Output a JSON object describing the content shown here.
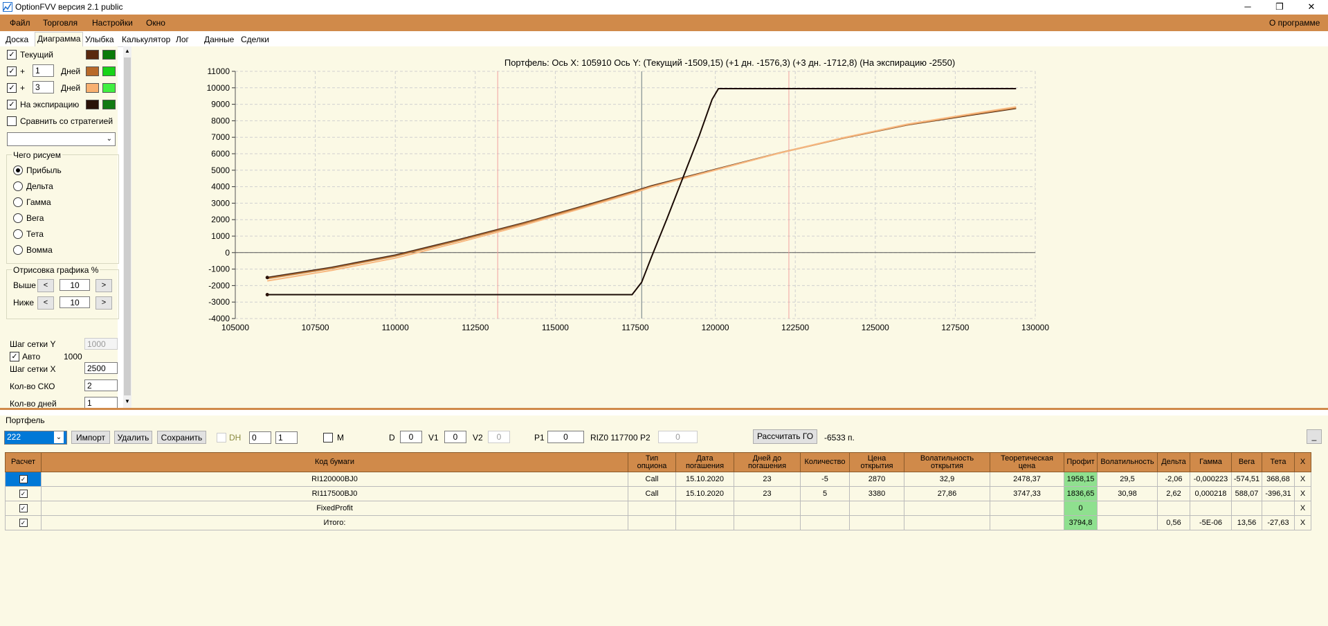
{
  "window": {
    "title": "OptionFVV версия 2.1 public",
    "minimize": "─",
    "restore": "❐",
    "close": "✕"
  },
  "menu": {
    "items": [
      "Файл",
      "Торговля",
      "Настройки",
      "Окно"
    ],
    "about": "О программе"
  },
  "tabs": [
    "Доска",
    "Диаграмма",
    "Улыбка",
    "Калькулятор",
    "Лог",
    "Данные",
    "Сделки"
  ],
  "active_tab": "Диаграмма",
  "left": {
    "current_label": "Текущий",
    "current_checked": "✓",
    "plus1": "+",
    "plus1_value": "1",
    "days1": "Дней",
    "plus3": "+",
    "plus3_value": "3",
    "days3": "Дней",
    "expiry_label": "На экспирацию",
    "compare_label": "Сравнить со стратегией",
    "compare_select": "",
    "what_title": "Чего рисуем",
    "radios": [
      "Прибыль",
      "Дельта",
      "Гамма",
      "Вега",
      "Тета",
      "Вомма"
    ],
    "draw_title": "Отрисовка графика %",
    "above_label": "Выше",
    "above_value": "10",
    "below_label": "Ниже",
    "below_value": "10",
    "arrow_left": "<",
    "arrow_right": ">",
    "grid_y_label": "Шаг сетки Y",
    "grid_y_value": "1000",
    "auto_label": "Авто",
    "auto_value": "1000",
    "grid_x_label": "Шаг сетки X",
    "grid_x_value": "2500",
    "sko_label": "Кол-во СКО",
    "sko_value": "2",
    "days_label": "Кол-во дней",
    "days_value": "1",
    "colors": {
      "current_a": "#5a2a10",
      "current_b": "#0a7a0a",
      "d1_a": "#b86a2a",
      "d1_b": "#18d418",
      "d3_a": "#f8b070",
      "d3_b": "#40f040",
      "exp_a": "#2a1208",
      "exp_b": "#127a12"
    }
  },
  "chart_header": "Портфель: Ось X:  105910 Ось Y:   (Текущий -1509,15)  (+1 дн. -1576,3)  (+3 дн. -1712,8)  (На экспирацию -2550)",
  "chart_data": {
    "type": "line",
    "xlim": [
      105000,
      130000
    ],
    "ylim": [
      -4000,
      11000
    ],
    "x_ticks": [
      "105000",
      "107500",
      "110000",
      "112500",
      "115000",
      "117500",
      "120000",
      "122500",
      "125000",
      "127500",
      "130000"
    ],
    "y_ticks": [
      "11000",
      "10000",
      "9000",
      "8000",
      "7000",
      "6000",
      "5000",
      "4000",
      "3000",
      "2000",
      "1000",
      "0",
      "-1000",
      "-2000",
      "-3000",
      "-4000"
    ],
    "x_tick_values": [
      105000,
      107500,
      110000,
      112500,
      115000,
      117500,
      120000,
      122500,
      125000,
      127500,
      130000
    ],
    "y_tick_values": [
      11000,
      10000,
      9000,
      8000,
      7000,
      6000,
      5000,
      4000,
      3000,
      2000,
      1000,
      0,
      -1000,
      -2000,
      -3000,
      -4000
    ],
    "cursor_x": 117700,
    "sigma_lines": [
      113200,
      122300
    ],
    "series": [
      {
        "color": "#4a2a1a",
        "x": [
          106000,
          108000,
          110000,
          112000,
          114000,
          116000,
          117500,
          118000,
          120000,
          122000,
          124000,
          126000,
          128000,
          129400
        ],
        "y": [
          -1510,
          -900,
          -150,
          800,
          1800,
          2900,
          3750,
          4050,
          5050,
          6050,
          6950,
          7750,
          8350,
          8750
        ]
      },
      {
        "color": "#c07a3a",
        "x": [
          106000,
          108000,
          110000,
          112000,
          114000,
          116000,
          117500,
          118000,
          120000,
          122000,
          124000,
          126000,
          128000,
          129400
        ],
        "y": [
          -1576,
          -960,
          -210,
          740,
          1750,
          2850,
          3710,
          4010,
          5030,
          6040,
          6950,
          7760,
          8380,
          8790
        ]
      },
      {
        "color": "#f8b880",
        "x": [
          106000,
          108000,
          110000,
          112000,
          114000,
          116000,
          117500,
          118000,
          120000,
          122000,
          124000,
          126000,
          128000,
          129400
        ],
        "y": [
          -1713,
          -1080,
          -330,
          630,
          1660,
          2780,
          3650,
          3970,
          5010,
          6040,
          6970,
          7790,
          8420,
          8840
        ]
      },
      {
        "color": "#1a0a04",
        "x": [
          106000,
          117400,
          117700,
          118000,
          118500,
          119000,
          119500,
          119900,
          120100,
          129400
        ],
        "y": [
          -2550,
          -2550,
          -1800,
          -300,
          2100,
          4600,
          7100,
          9300,
          9950,
          9950
        ]
      }
    ]
  },
  "portfolio": {
    "title": "Портфель",
    "select": "222",
    "import": "Импорт",
    "delete": "Удалить",
    "save": "Сохранить",
    "dh": "DH",
    "dh_a": "0",
    "dh_b": "1",
    "m": "M",
    "d_label": "D",
    "d_value": "0",
    "v1_label": "V1",
    "v1_value": "0",
    "v2_label": "V2",
    "v2_value": "0",
    "p1_label": "P1",
    "p1_value": "0",
    "riz": "RIZ0 117700",
    "p2_label": "P2",
    "p2_value": "0",
    "calc_go": "Рассчитать ГО",
    "go_value": "-6533 п.",
    "collapse": "_",
    "up": "▲",
    "down": "▼"
  },
  "table": {
    "headers": [
      "Расчет",
      "Код бумаги",
      "Тип опциона",
      "Дата погашения",
      "Дней до погашения",
      "Количество",
      "Цена открытия",
      "Волатильность открытия",
      "Теоретическая цена",
      "Профит",
      "Волатильность",
      "Дельта",
      "Гамма",
      "Вега",
      "Тета",
      "X"
    ],
    "rows": [
      [
        "✓",
        "RI120000BJ0",
        "Call",
        "15.10.2020",
        "23",
        "-5",
        "2870",
        "32,9",
        "2478,37",
        "1958,15",
        "29,5",
        "-2,06",
        "-0,000223",
        "-574,51",
        "368,68",
        "X"
      ],
      [
        "✓",
        "RI117500BJ0",
        "Call",
        "15.10.2020",
        "23",
        "5",
        "3380",
        "27,86",
        "3747,33",
        "1836,65",
        "30,98",
        "2,62",
        "0,000218",
        "588,07",
        "-396,31",
        "X"
      ],
      [
        "✓",
        "FixedProfit",
        "",
        "",
        "",
        "",
        "",
        "",
        "",
        "0",
        "",
        "",
        "",
        "",
        "",
        "X"
      ],
      [
        "✓",
        "Итого:",
        "",
        "",
        "",
        "",
        "",
        "",
        "",
        "3794,8",
        "",
        "0,56",
        "-5E-06",
        "13,56",
        "-27,63",
        "X"
      ]
    ]
  }
}
